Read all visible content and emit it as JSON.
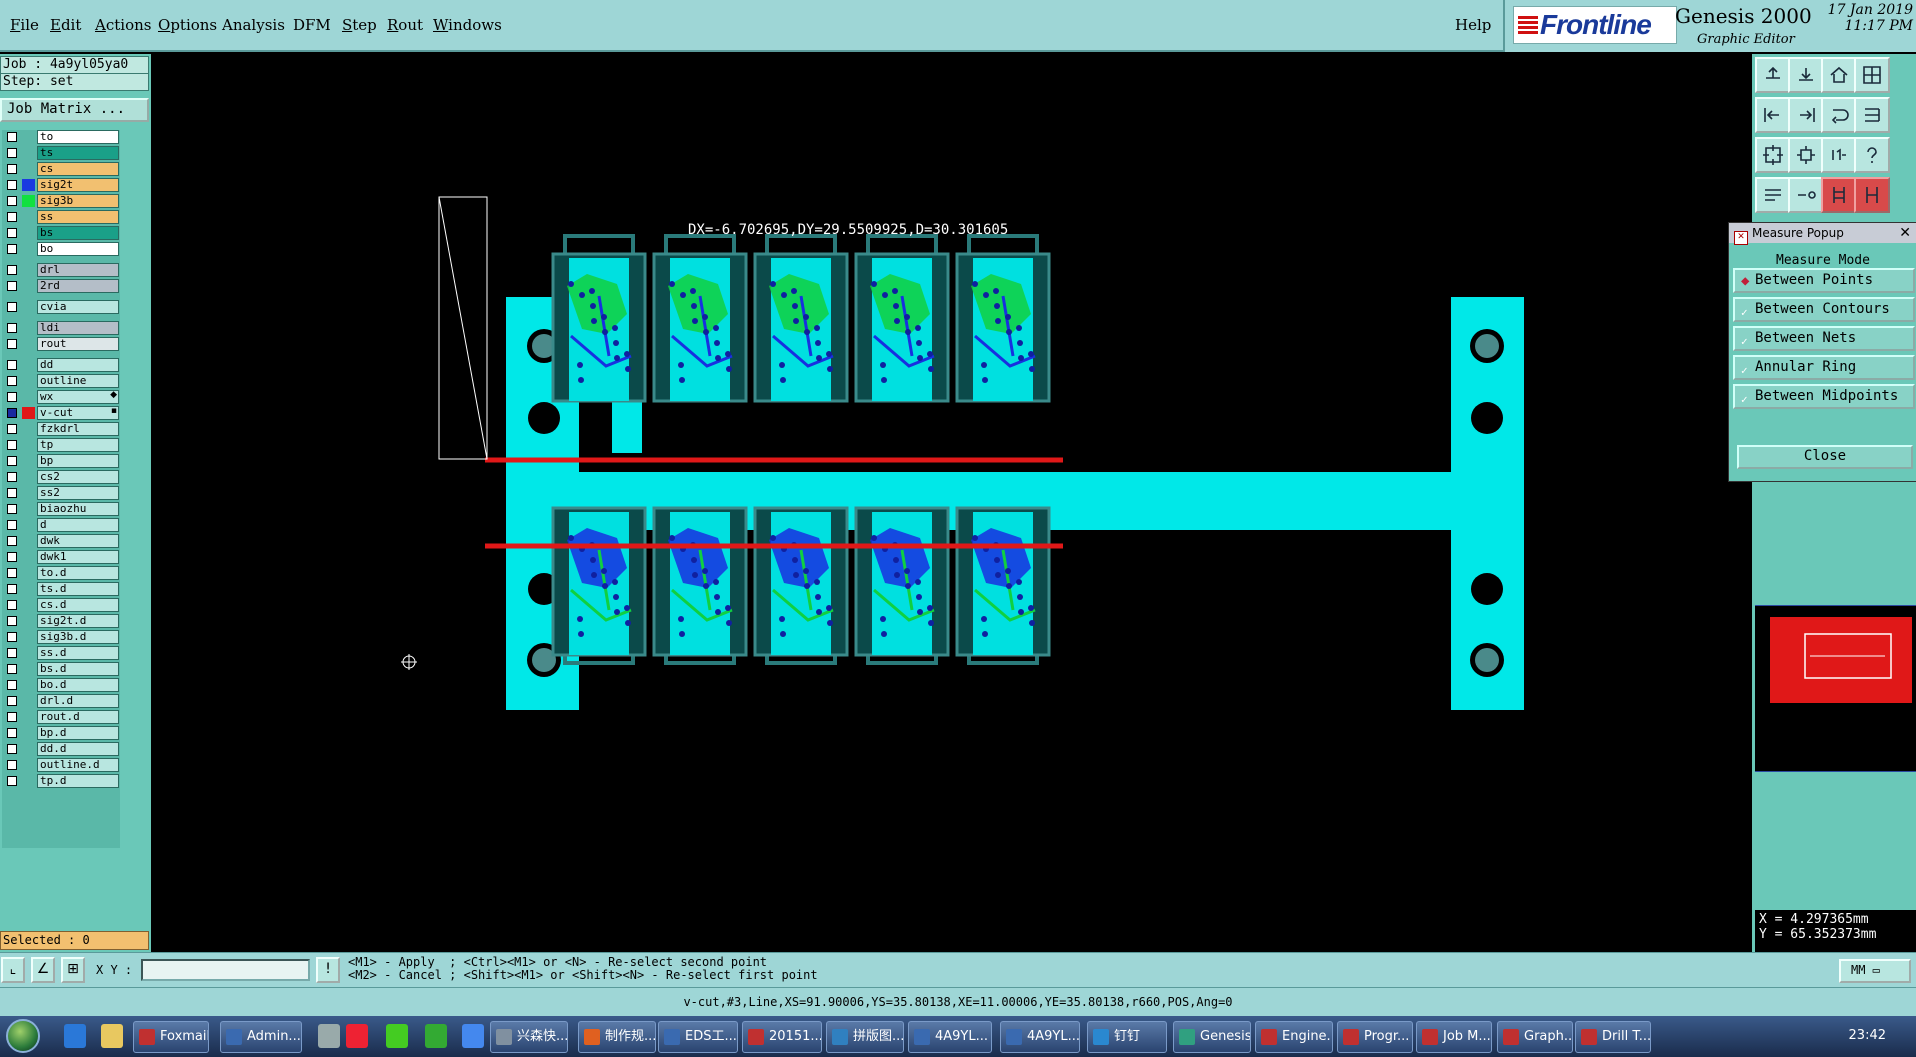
{
  "menu": {
    "items": [
      {
        "label": "File",
        "ul": "F",
        "rest": "ile"
      },
      {
        "label": "Edit",
        "ul": "E",
        "rest": "dit"
      },
      {
        "label": "Actions",
        "ul": "A",
        "rest": "ctions"
      },
      {
        "label": "Options",
        "ul": "O",
        "rest": "ptions"
      },
      {
        "label": "Analysis",
        "ul": "",
        "rest": "Analysis"
      },
      {
        "label": "DFM",
        "ul": "",
        "rest": "DFM"
      },
      {
        "label": "Step",
        "ul": "S",
        "rest": "tep"
      },
      {
        "label": "Rout",
        "ul": "R",
        "rest": "out"
      },
      {
        "label": "Windows",
        "ul": "W",
        "rest": "indows"
      }
    ],
    "help": "Help"
  },
  "brand": {
    "logo": "Frontline",
    "product": "Genesis 2000",
    "subtitle": "Graphic Editor",
    "date": "17 Jan 2019",
    "time": "11:17 PM"
  },
  "job": {
    "job_line": "Job : 4a9yl05ya0",
    "step_line": "Step: set",
    "matrix_button": "Job Matrix ..."
  },
  "layers": [
    {
      "name": "to",
      "color": "#ffffff",
      "swatch": ""
    },
    {
      "name": "ts",
      "color": "#1aa088",
      "swatch": ""
    },
    {
      "name": "cs",
      "color": "#f2c070",
      "swatch": ""
    },
    {
      "name": "sig2t",
      "color": "#f2c070",
      "swatch": "#1a3ae0"
    },
    {
      "name": "sig3b",
      "color": "#f2c070",
      "swatch": "#10e040"
    },
    {
      "name": "ss",
      "color": "#f2c070",
      "swatch": ""
    },
    {
      "name": "bs",
      "color": "#1aa088",
      "swatch": ""
    },
    {
      "name": "bo",
      "color": "#ffffff",
      "swatch": ""
    },
    {
      "name": "drl",
      "color": "#b4bec8",
      "swatch": ""
    },
    {
      "name": "2rd",
      "color": "#b4bec8",
      "swatch": ""
    },
    {
      "name": "cvia",
      "color": "#b8e6e0",
      "swatch": ""
    },
    {
      "name": "ldi",
      "color": "#b4bec8",
      "swatch": ""
    },
    {
      "name": "rout",
      "color": "#dde6e8",
      "swatch": ""
    },
    {
      "name": "dd",
      "color": "#b8e6e0",
      "swatch": ""
    },
    {
      "name": "outline",
      "color": "#b8e6e0",
      "swatch": ""
    },
    {
      "name": "wx",
      "color": "#b8e6e0",
      "swatch": "",
      "mark": "◆"
    },
    {
      "name": "v-cut",
      "color": "#b8e6e0",
      "swatch": "#e01818",
      "mark": "▪",
      "active": true
    },
    {
      "name": "fzkdrl",
      "color": "#b8e6e0",
      "swatch": ""
    },
    {
      "name": "tp",
      "color": "#b8e6e0",
      "swatch": ""
    },
    {
      "name": "bp",
      "color": "#b8e6e0",
      "swatch": ""
    },
    {
      "name": "cs2",
      "color": "#b8e6e0",
      "swatch": ""
    },
    {
      "name": "ss2",
      "color": "#b8e6e0",
      "swatch": ""
    },
    {
      "name": "biaozhu",
      "color": "#b8e6e0",
      "swatch": ""
    },
    {
      "name": "d",
      "color": "#b8e6e0",
      "swatch": ""
    },
    {
      "name": "dwk",
      "color": "#b8e6e0",
      "swatch": ""
    },
    {
      "name": "dwk1",
      "color": "#b8e6e0",
      "swatch": ""
    },
    {
      "name": "to.d",
      "color": "#b8e6e0",
      "swatch": ""
    },
    {
      "name": "ts.d",
      "color": "#b8e6e0",
      "swatch": ""
    },
    {
      "name": "cs.d",
      "color": "#b8e6e0",
      "swatch": ""
    },
    {
      "name": "sig2t.d",
      "color": "#b8e6e0",
      "swatch": ""
    },
    {
      "name": "sig3b.d",
      "color": "#b8e6e0",
      "swatch": ""
    },
    {
      "name": "ss.d",
      "color": "#b8e6e0",
      "swatch": ""
    },
    {
      "name": "bs.d",
      "color": "#b8e6e0",
      "swatch": ""
    },
    {
      "name": "bo.d",
      "color": "#b8e6e0",
      "swatch": ""
    },
    {
      "name": "drl.d",
      "color": "#b8e6e0",
      "swatch": ""
    },
    {
      "name": "rout.d",
      "color": "#b8e6e0",
      "swatch": ""
    },
    {
      "name": "bp.d",
      "color": "#b8e6e0",
      "swatch": ""
    },
    {
      "name": "dd.d",
      "color": "#b8e6e0",
      "swatch": ""
    },
    {
      "name": "outline.d",
      "color": "#b8e6e0",
      "swatch": ""
    },
    {
      "name": "tp.d",
      "color": "#b8e6e0",
      "swatch": ""
    }
  ],
  "selected": "Selected : 0",
  "measure_readout": "DX=-6.702695,DY=29.5509925,D=30.301605",
  "measure_popup": {
    "title": "Measure Popup",
    "mode_label": "Measure Mode",
    "options": [
      "Between Points",
      "Between Contours",
      "Between Nets",
      "Annular Ring",
      "Between Midpoints"
    ],
    "selected": "Between Points",
    "close": "Close"
  },
  "coords": {
    "x": "X = 4.297365mm",
    "y": "Y = 65.352373mm"
  },
  "bottom": {
    "xy_label": "X Y :",
    "xy_value": "",
    "hint1": "<M1> - Apply  ; <Ctrl><M1> or <N> - Re-select second point",
    "hint2": "<M2> - Cancel ; <Shift><M1> or <Shift><N> - Re-select first point",
    "units": "MM",
    "entity": "v-cut,#3,Line,XS=91.90006,YS=35.80138,XE=11.00006,YE=35.80138,r660,POS,Ang=0"
  },
  "taskbar": {
    "tasks": [
      "Foxmail",
      "Admin...",
      "兴森快...",
      "制作规...",
      "EDS工...",
      "20151...",
      "拼版图...",
      "4A9YL...",
      "4A9YL...",
      "钉钉",
      "Genesis",
      "Engine...",
      "Progr...",
      "Job M...",
      "Graph...",
      "Drill T..."
    ],
    "clock": "23:42"
  },
  "colors": {
    "menubar": "#9ed6d6",
    "panel": "#6ac8b8",
    "board": "#00e8e8",
    "vcut": "#e01818",
    "trace_green": "#10d040",
    "trace_blue": "#1830e0"
  }
}
